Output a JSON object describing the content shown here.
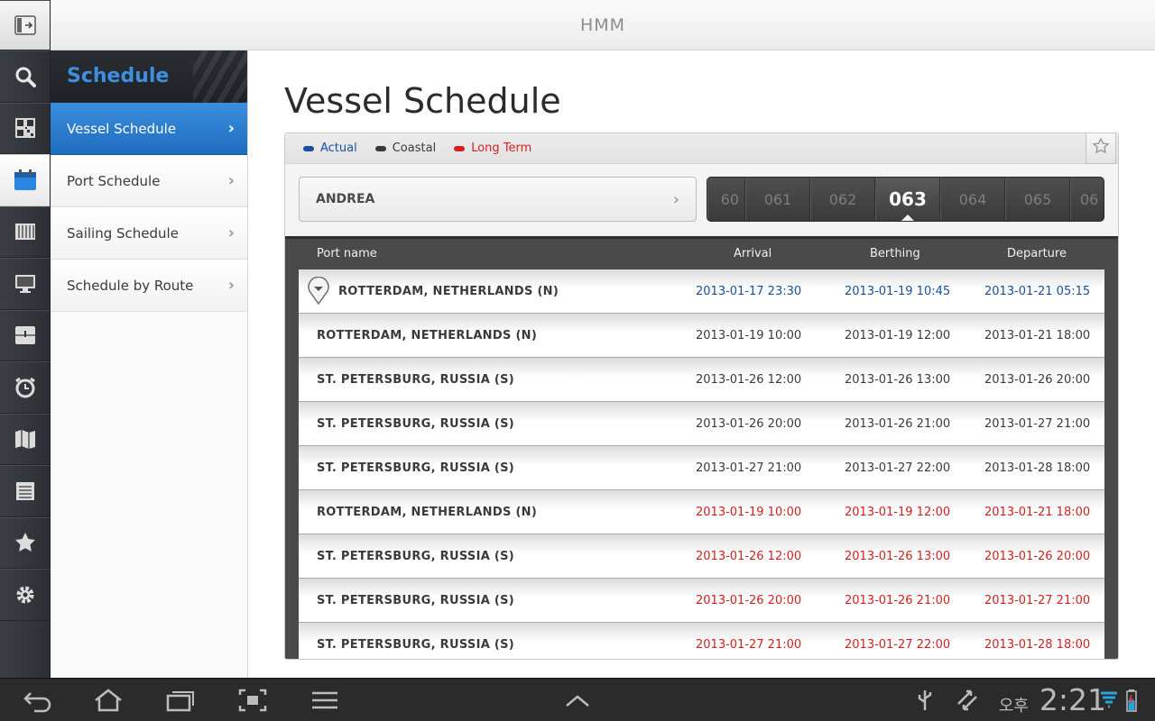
{
  "app": {
    "title": "HMM"
  },
  "rail": {
    "items": [
      {
        "name": "collapse-icon",
        "active": false
      },
      {
        "name": "search-icon",
        "active": false
      },
      {
        "name": "qr-code-icon",
        "active": false
      },
      {
        "name": "calendar-icon",
        "active": true
      },
      {
        "name": "container-icon",
        "active": false
      },
      {
        "name": "monitor-icon",
        "active": false
      },
      {
        "name": "info-box-icon",
        "active": false
      },
      {
        "name": "alarm-clock-icon",
        "active": false
      },
      {
        "name": "map-icon",
        "active": false
      },
      {
        "name": "list-icon",
        "active": false
      },
      {
        "name": "star-icon",
        "active": false
      },
      {
        "name": "gear-icon",
        "active": false
      }
    ]
  },
  "subnav": {
    "header": "Schedule",
    "items": [
      {
        "label": "Vessel Schedule",
        "active": true
      },
      {
        "label": "Port Schedule",
        "active": false
      },
      {
        "label": "Sailing Schedule",
        "active": false
      },
      {
        "label": "Schedule by Route",
        "active": false
      }
    ]
  },
  "main": {
    "title": "Vessel Schedule",
    "legend": [
      {
        "label": "Actual",
        "color": "#1a4fa0"
      },
      {
        "label": "Coastal",
        "color": "#3a3a3a"
      },
      {
        "label": "Long Term",
        "color": "#d42020"
      }
    ],
    "vessel": "ANDREA",
    "voyages": [
      "60",
      "061",
      "062",
      "063",
      "064",
      "065",
      "06"
    ],
    "selected_voyage": "063",
    "columns": {
      "port": "Port name",
      "arrival": "Arrival",
      "berthing": "Berthing",
      "departure": "Departure"
    },
    "rows": [
      {
        "port": "ROTTERDAM, NETHERLANDS (N)",
        "arrival": "2013-01-17 23:30",
        "berthing": "2013-01-19 10:45",
        "departure": "2013-01-21 05:15",
        "kind": "actual"
      },
      {
        "port": "ROTTERDAM, NETHERLANDS (N)",
        "arrival": "2013-01-19 10:00",
        "berthing": "2013-01-19 12:00",
        "departure": "2013-01-21 18:00",
        "kind": "coastal"
      },
      {
        "port": "ST. PETERSBURG, RUSSIA (S)",
        "arrival": "2013-01-26 12:00",
        "berthing": "2013-01-26 13:00",
        "departure": "2013-01-26 20:00",
        "kind": "coastal"
      },
      {
        "port": "ST. PETERSBURG, RUSSIA (S)",
        "arrival": "2013-01-26 20:00",
        "berthing": "2013-01-26 21:00",
        "departure": "2013-01-27 21:00",
        "kind": "coastal"
      },
      {
        "port": "ST. PETERSBURG, RUSSIA (S)",
        "arrival": "2013-01-27 21:00",
        "berthing": "2013-01-27 22:00",
        "departure": "2013-01-28 18:00",
        "kind": "coastal"
      },
      {
        "port": "ROTTERDAM, NETHERLANDS (N)",
        "arrival": "2013-01-19 10:00",
        "berthing": "2013-01-19 12:00",
        "departure": "2013-01-21 18:00",
        "kind": "longterm"
      },
      {
        "port": "ST. PETERSBURG, RUSSIA (S)",
        "arrival": "2013-01-26 12:00",
        "berthing": "2013-01-26 13:00",
        "departure": "2013-01-26 20:00",
        "kind": "longterm"
      },
      {
        "port": "ST. PETERSBURG, RUSSIA (S)",
        "arrival": "2013-01-26 20:00",
        "berthing": "2013-01-26 21:00",
        "departure": "2013-01-27 21:00",
        "kind": "longterm"
      },
      {
        "port": "ST. PETERSBURG, RUSSIA (S)",
        "arrival": "2013-01-27 21:00",
        "berthing": "2013-01-27 22:00",
        "departure": "2013-01-28 18:00",
        "kind": "longterm"
      }
    ],
    "colors": {
      "actual": "#1a4fa0",
      "coastal": "#3a3a3a",
      "longterm": "#d42020"
    }
  },
  "status_bar": {
    "ampm": "오후",
    "time": "2:21"
  }
}
